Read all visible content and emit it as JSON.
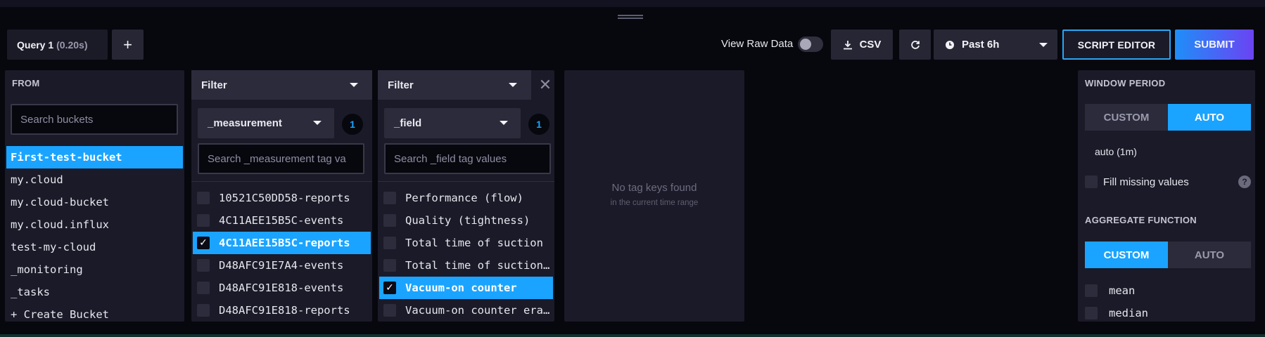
{
  "query": {
    "tab_label": "Query 1",
    "tab_time": "(0.20s)",
    "add_label": "+"
  },
  "toolbar": {
    "raw_label": "View Raw Data",
    "csv_label": "CSV",
    "timerange_label": "Past 6h",
    "script_editor_label": "SCRIPT EDITOR",
    "submit_label": "SUBMIT"
  },
  "from": {
    "title": "FROM",
    "search_placeholder": "Search buckets",
    "buckets": [
      "First-test-bucket",
      "my.cloud",
      "my.cloud-bucket",
      "my.cloud.influx",
      "test-my-cloud",
      "_monitoring",
      "_tasks",
      "+ Create Bucket"
    ],
    "selected_index": 0
  },
  "filter1": {
    "title": "Filter",
    "key": "_measurement",
    "count": "1",
    "search_placeholder": "Search _measurement tag va",
    "values": [
      {
        "label": "10521C50DD58-reports",
        "checked": false
      },
      {
        "label": "4C11AEE15B5C-events",
        "checked": false
      },
      {
        "label": "4C11AEE15B5C-reports",
        "checked": true
      },
      {
        "label": "D48AFC91E7A4-events",
        "checked": false
      },
      {
        "label": "D48AFC91E818-events",
        "checked": false
      },
      {
        "label": "D48AFC91E818-reports",
        "checked": false
      }
    ]
  },
  "filter2": {
    "title": "Filter",
    "key": "_field",
    "count": "1",
    "search_placeholder": "Search _field tag values",
    "values": [
      {
        "label": "Performance (flow)",
        "checked": false
      },
      {
        "label": "Quality (tightness)",
        "checked": false
      },
      {
        "label": "Total time of suction",
        "checked": false
      },
      {
        "label": "Total time of suction...",
        "checked": false
      },
      {
        "label": "Vacuum-on counter",
        "checked": true
      },
      {
        "label": "Vacuum-on counter era...",
        "checked": false
      }
    ]
  },
  "empty": {
    "title": "No tag keys found",
    "subtitle": "in the current time range"
  },
  "window": {
    "title": "WINDOW PERIOD",
    "custom_label": "CUSTOM",
    "auto_label": "AUTO",
    "period_value": "auto (1m)",
    "fill_label": "Fill missing values",
    "help": "?"
  },
  "aggregate": {
    "title": "AGGREGATE FUNCTION",
    "custom_label": "CUSTOM",
    "auto_label": "AUTO",
    "functions": [
      "mean",
      "median"
    ]
  },
  "colors": {
    "accent": "#1aa4ff",
    "panel": "#1a1a28",
    "background": "#07070e"
  }
}
